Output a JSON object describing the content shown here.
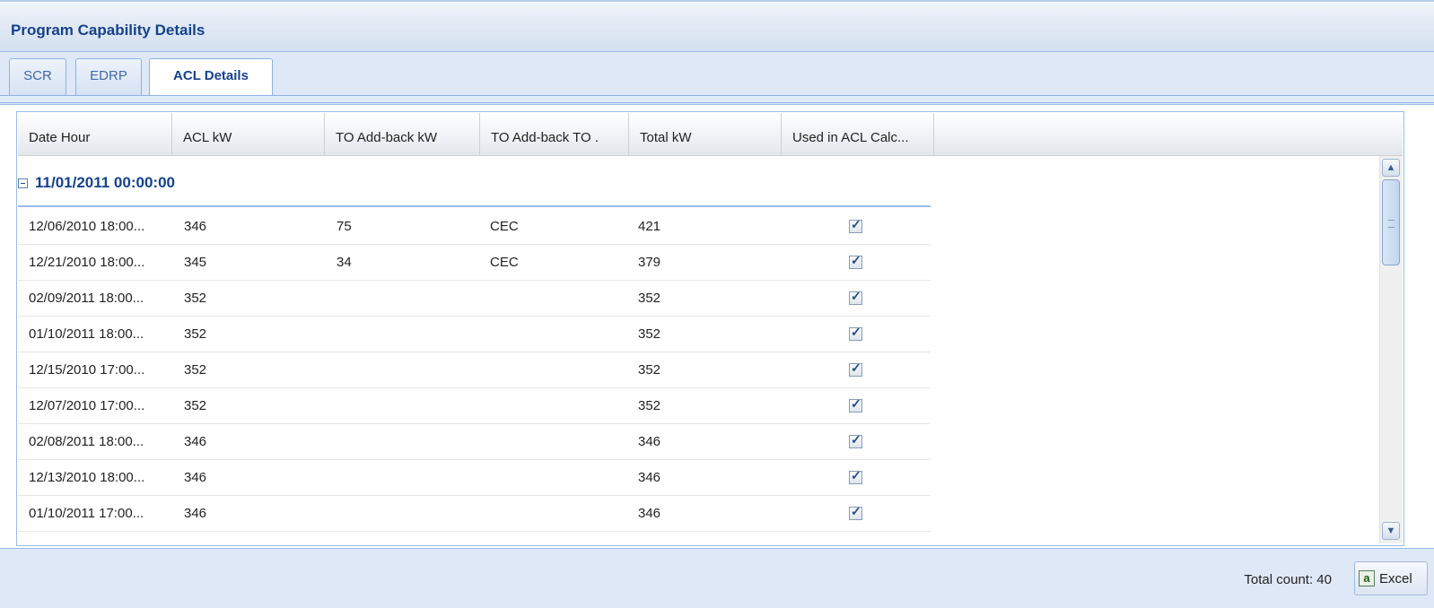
{
  "panel": {
    "title": "Program Capability Details"
  },
  "tabs": [
    {
      "label": "SCR"
    },
    {
      "label": "EDRP"
    },
    {
      "label": "ACL Details"
    }
  ],
  "grid": {
    "columns": [
      "Date Hour",
      "ACL kW",
      "TO Add-back kW",
      "TO Add-back TO .",
      "Total kW",
      "Used in ACL Calc..."
    ],
    "group_label": "11/01/2011 00:00:00",
    "rows": [
      {
        "date_hour": "12/06/2010 18:00...",
        "acl_kw": "346",
        "to_addback_kw": "75",
        "to_addback_to": "CEC",
        "total_kw": "421",
        "used": true
      },
      {
        "date_hour": "12/21/2010 18:00...",
        "acl_kw": "345",
        "to_addback_kw": "34",
        "to_addback_to": "CEC",
        "total_kw": "379",
        "used": true
      },
      {
        "date_hour": "02/09/2011 18:00...",
        "acl_kw": "352",
        "to_addback_kw": "",
        "to_addback_to": "",
        "total_kw": "352",
        "used": true
      },
      {
        "date_hour": "01/10/2011 18:00...",
        "acl_kw": "352",
        "to_addback_kw": "",
        "to_addback_to": "",
        "total_kw": "352",
        "used": true
      },
      {
        "date_hour": "12/15/2010 17:00...",
        "acl_kw": "352",
        "to_addback_kw": "",
        "to_addback_to": "",
        "total_kw": "352",
        "used": true
      },
      {
        "date_hour": "12/07/2010 17:00...",
        "acl_kw": "352",
        "to_addback_kw": "",
        "to_addback_to": "",
        "total_kw": "352",
        "used": true
      },
      {
        "date_hour": "02/08/2011 18:00...",
        "acl_kw": "346",
        "to_addback_kw": "",
        "to_addback_to": "",
        "total_kw": "346",
        "used": true
      },
      {
        "date_hour": "12/13/2010 18:00...",
        "acl_kw": "346",
        "to_addback_kw": "",
        "to_addback_to": "",
        "total_kw": "346",
        "used": true
      },
      {
        "date_hour": "01/10/2011 17:00...",
        "acl_kw": "346",
        "to_addback_kw": "",
        "to_addback_to": "",
        "total_kw": "346",
        "used": true
      }
    ]
  },
  "footer": {
    "total_count_label": "Total count: 40",
    "excel_label": "Excel",
    "excel_icon_glyph": "a"
  },
  "colors": {
    "header_text": "#15428b",
    "border": "#99bbe8",
    "footer_bg": "#dfe8f6"
  }
}
